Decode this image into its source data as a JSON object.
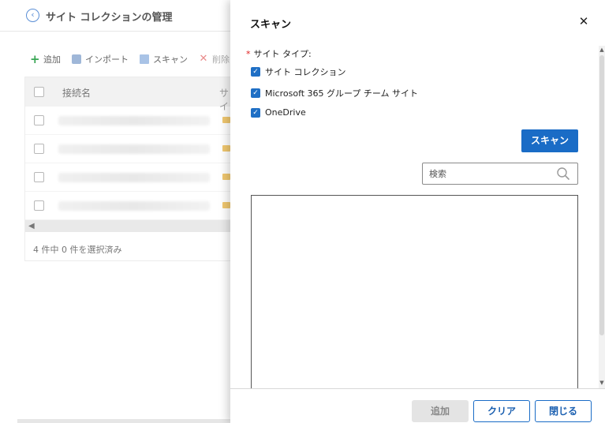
{
  "background": {
    "title": "サイト コレクションの管理",
    "toolbar": {
      "add": "追加",
      "import": "インポート",
      "scan": "スキャン",
      "delete": "削除"
    },
    "table": {
      "columns": [
        "接続名",
        "サイ"
      ],
      "row_count": 4,
      "footer": "4 件中 0 件を選択済み"
    }
  },
  "panel": {
    "title": "スキャン",
    "site_type": {
      "required_mark": "*",
      "label": "サイト タイプ:",
      "options": [
        {
          "label": "サイト コレクション",
          "checked": true
        },
        {
          "label": "Microsoft 365 グループ チーム サイト",
          "checked": true
        },
        {
          "label": "OneDrive",
          "checked": true
        }
      ]
    },
    "scan_button": "スキャン",
    "search": {
      "placeholder": "検索",
      "value": ""
    },
    "footer": {
      "add": "追加",
      "clear": "クリア",
      "close": "閉じる"
    }
  },
  "colors": {
    "accent": "#1a6cc6",
    "required": "#e02020",
    "checkbox": "#1f6fc5"
  }
}
